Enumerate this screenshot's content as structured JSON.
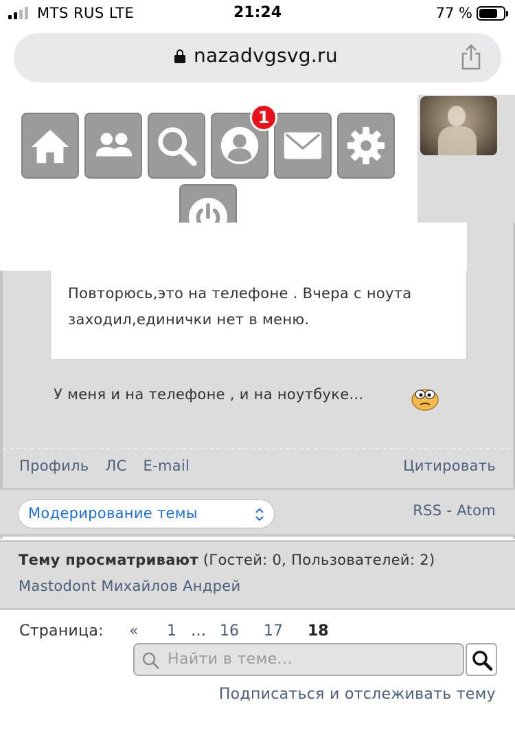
{
  "status_bar": {
    "carrier": "MTS RUS  LTE",
    "time": "21:24",
    "battery": "77 %",
    "battery_level": 0.77
  },
  "browser": {
    "url": "nazadvgsvg.ru"
  },
  "nav": {
    "notification_count": "1",
    "icons": [
      "home-icon",
      "users-icon",
      "search-icon",
      "profile-icon",
      "mail-icon",
      "gear-icon",
      "power-icon"
    ]
  },
  "post": {
    "quote_text": "Повторюсь,это на телефоне . Вчера с ноута заходил,единички нет в меню.",
    "reply_text": "У меня и на телефоне , и на ноутбуке...",
    "links": [
      "Профиль",
      "ЛС",
      "E-mail"
    ],
    "quote_link": "Цитировать"
  },
  "moderation": {
    "select_value": "Модерирование темы",
    "rss_label": "RSS - Atom"
  },
  "viewers": {
    "title": "Тему просматривают",
    "counts": "(Гостей: 0, Пользователей: 2)",
    "users": "Mastodont Михайлов Андрей"
  },
  "pagination": {
    "label": "Страница:",
    "prev": "«",
    "pages": [
      "1",
      "…",
      "16",
      "17",
      "18"
    ],
    "current": "18"
  },
  "search": {
    "placeholder": "Найти в теме..."
  },
  "subscribe_label": "Подписаться и отслеживать тему",
  "colors": {
    "nav_button": "#9b9b9b",
    "link": "#4a5f7a",
    "badge": "#e8101a",
    "panel": "#dcdcdc",
    "select_text": "#1a6ee0"
  }
}
